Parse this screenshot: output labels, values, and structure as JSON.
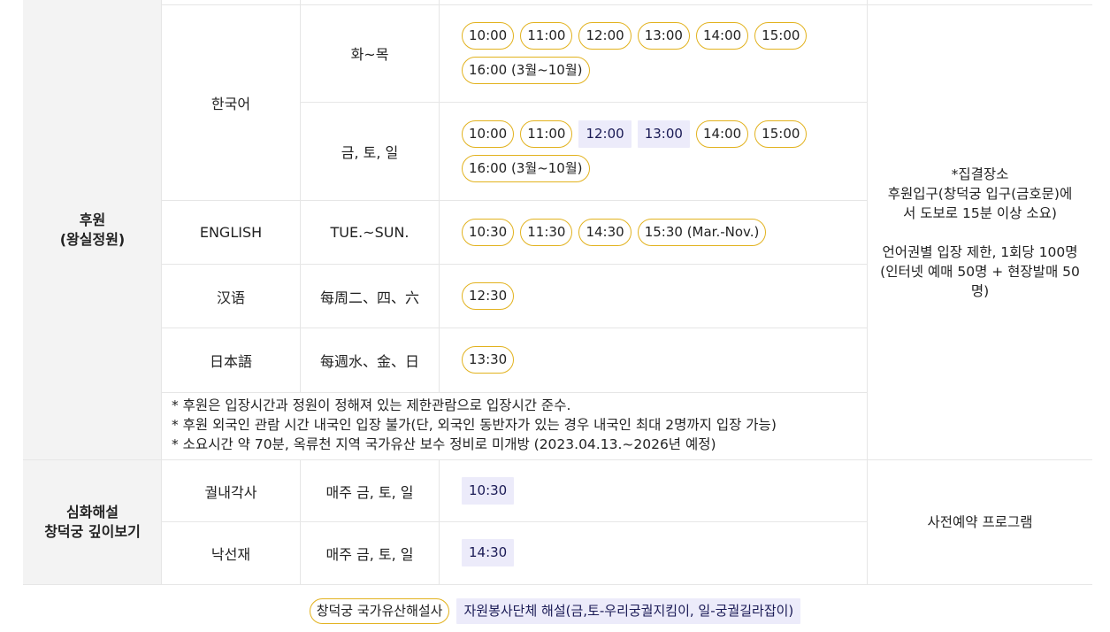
{
  "huwon": {
    "category": "후원\n(왕실정원)",
    "rows": [
      {
        "language": "한국어",
        "days": "화~목",
        "times": [
          {
            "t": "10:00",
            "k": "gold"
          },
          {
            "t": "11:00",
            "k": "gold"
          },
          {
            "t": "12:00",
            "k": "gold"
          },
          {
            "t": "13:00",
            "k": "gold"
          },
          {
            "t": "14:00",
            "k": "gold"
          },
          {
            "t": "15:00",
            "k": "gold"
          },
          {
            "t": "16:00 (3월~10월)",
            "k": "gold"
          }
        ]
      },
      {
        "language": "한국어",
        "days": "금, 토, 일",
        "times": [
          {
            "t": "10:00",
            "k": "gold"
          },
          {
            "t": "11:00",
            "k": "gold"
          },
          {
            "t": "12:00",
            "k": "vol"
          },
          {
            "t": "13:00",
            "k": "vol"
          },
          {
            "t": "14:00",
            "k": "gold"
          },
          {
            "t": "15:00",
            "k": "gold"
          },
          {
            "t": "16:00 (3월~10월)",
            "k": "gold"
          }
        ]
      },
      {
        "language": "ENGLISH",
        "days": "TUE.~SUN.",
        "times": [
          {
            "t": "10:30",
            "k": "gold"
          },
          {
            "t": "11:30",
            "k": "gold"
          },
          {
            "t": "14:30",
            "k": "gold"
          },
          {
            "t": "15:30 (Mar.-Nov.)",
            "k": "gold"
          }
        ]
      },
      {
        "language": "汉语",
        "days": "每周二、四、六",
        "times": [
          {
            "t": "12:30",
            "k": "gold"
          }
        ]
      },
      {
        "language": "日本語",
        "days": "每週水、金、日",
        "times": [
          {
            "t": "13:30",
            "k": "gold"
          }
        ]
      }
    ],
    "notes": [
      "* 후원은 입장시간과 정원이 정해져 있는 제한관람으로 입장시간 준수.",
      "* 후원 외국인 관람 시간 내국인 입장 불가(단, 외국인 동반자가 있는 경우 내국인 최대 2명까지 입장 가능)",
      "* 소요시간 약 70분, 옥류천 지역 국가유산 보수 정비로 미개방 (2023.04.13.~2026년 예정)"
    ],
    "side_note": "*집결장소\n후원입구(창덕궁 입구(금호문)에\n서 도보로 15분 이상 소요)\n\n언어권별 입장 제한, 1회당 100명\n(인터넷 예매 50명 + 현장발매 50\n명)"
  },
  "deep": {
    "category": "심화해설\n창덕궁 깊이보기",
    "rows": [
      {
        "place": "궐내각사",
        "days": "매주 금, 토, 일",
        "times": [
          {
            "t": "10:30",
            "k": "vol"
          }
        ]
      },
      {
        "place": "낙선재",
        "days": "매주 금, 토, 일",
        "times": [
          {
            "t": "14:30",
            "k": "vol"
          }
        ]
      }
    ],
    "side_note": "사전예약 프로그램"
  },
  "legend": {
    "heritage": "창덕궁 국가유산해설사",
    "volunteer": "자원봉사단체 해설(금,토-우리궁궐지킴이, 일-궁궐길라잡이)"
  },
  "colors": {
    "heritage_border": "#e2b21e",
    "volunteer_bg": "#ecebfa",
    "category_bg": "#f3f3f3"
  }
}
